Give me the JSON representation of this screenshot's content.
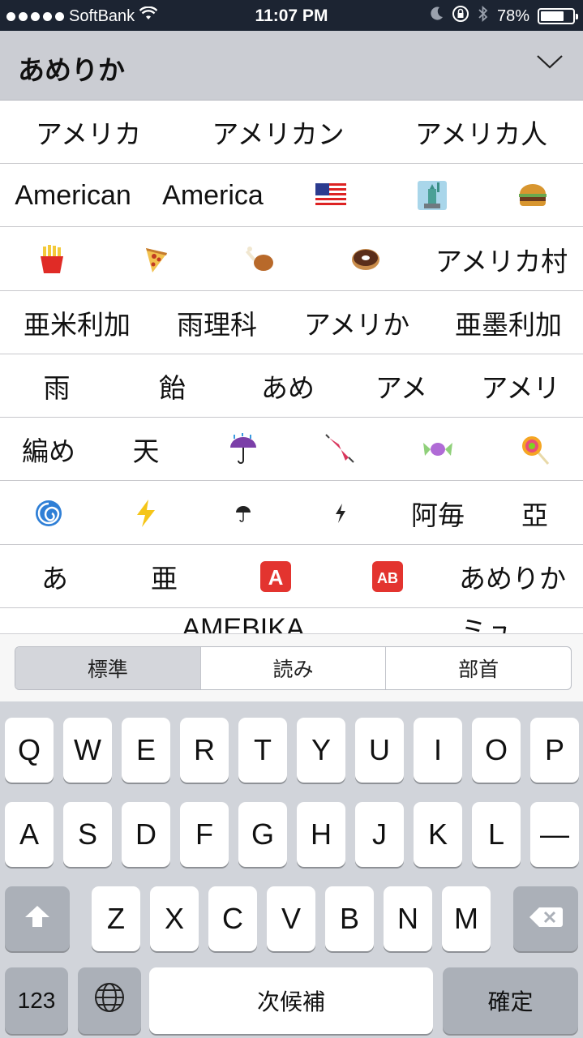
{
  "status": {
    "carrier": "SoftBank",
    "time": "11:07 PM",
    "battery_pct": "78%",
    "battery_level": 0.78
  },
  "candidate_bar": {
    "reading": "あめりか",
    "chevron": "chevron-down-icon"
  },
  "candidates": [
    [
      "アメリカ",
      "アメリカン",
      "アメリカ人"
    ],
    [
      "American",
      "America",
      "🇺🇸",
      "🗽",
      "🍔"
    ],
    [
      "🍟",
      "🍕",
      "🍗",
      "🍩",
      "アメリカ村"
    ],
    [
      "亜米利加",
      "雨理科",
      "アメリか",
      "亜墨利加"
    ],
    [
      "雨",
      "飴",
      "あめ",
      "アメ",
      "アメリ"
    ],
    [
      "編め",
      "天",
      "☔",
      "🌂",
      "🍬",
      "🍭"
    ],
    [
      "🌀",
      "⚡",
      "☔",
      "⚡",
      "阿毎",
      "亞"
    ],
    [
      "あ",
      "亜",
      "🅰",
      "🆎",
      "あめりか"
    ],
    [
      "",
      "AMEBIKA",
      "",
      "ミュ"
    ]
  ],
  "segments": {
    "standard": "標準",
    "reading": "読み",
    "radical": "部首"
  },
  "keyboard": {
    "row1": [
      "Q",
      "W",
      "E",
      "R",
      "T",
      "Y",
      "U",
      "I",
      "O",
      "P"
    ],
    "row2": [
      "A",
      "S",
      "D",
      "F",
      "G",
      "H",
      "J",
      "K",
      "L",
      "—"
    ],
    "row3": [
      "Z",
      "X",
      "C",
      "V",
      "B",
      "N",
      "M"
    ],
    "numbers": "123",
    "next_candidate": "次候補",
    "confirm": "確定"
  },
  "colors": {
    "status_bg": "#1c2432",
    "candidate_bar_bg": "#cbcdd3",
    "keyboard_bg": "#d1d4da",
    "dark_key": "#abb0b8"
  }
}
